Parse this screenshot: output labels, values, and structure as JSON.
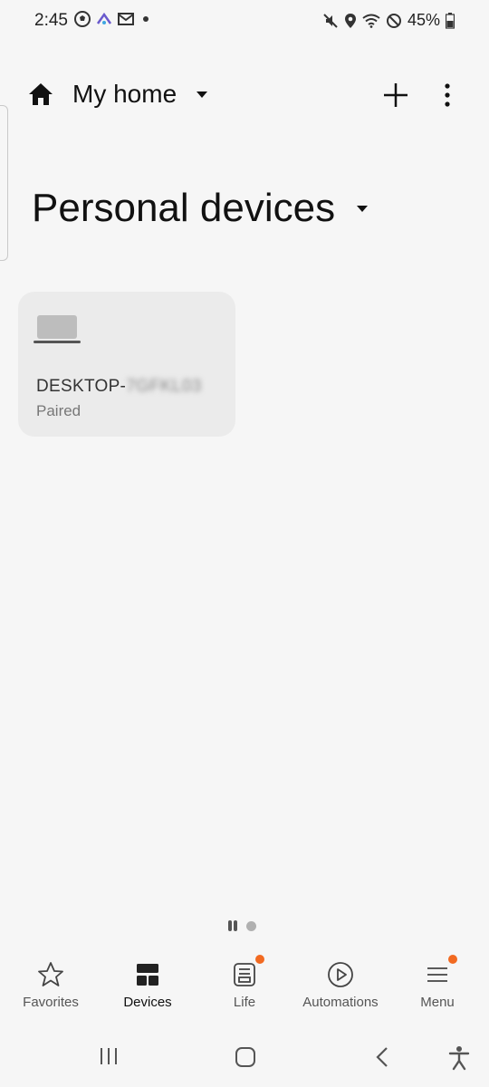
{
  "status_bar": {
    "time": "2:45",
    "battery": "45%",
    "left_icons": [
      "soccer-icon",
      "app-icon",
      "gmail-icon",
      "dot-icon"
    ],
    "right_icons": [
      "mute-icon",
      "location-icon",
      "wifi-icon",
      "blocked-icon",
      "battery-icon"
    ]
  },
  "header": {
    "home_name": "My home",
    "home_icon": "home-icon",
    "add_icon": "plus-icon",
    "more_icon": "more-vert-icon"
  },
  "section": {
    "title": "Personal devices"
  },
  "device": {
    "name_visible": "DESKTOP-",
    "name_blurred": "7GFKL03",
    "status": "Paired",
    "icon": "laptop-icon"
  },
  "bottom_nav": {
    "items": [
      {
        "label": "Favorites",
        "icon": "star-icon"
      },
      {
        "label": "Devices",
        "icon": "devices-grid-icon"
      },
      {
        "label": "Life",
        "icon": "life-icon"
      },
      {
        "label": "Automations",
        "icon": "play-circle-icon"
      },
      {
        "label": "Menu",
        "icon": "menu-icon"
      }
    ],
    "active": "Devices"
  },
  "colors": {
    "background": "#f6f6f6",
    "card": "#ebebeb",
    "badge": "#f26a21"
  }
}
